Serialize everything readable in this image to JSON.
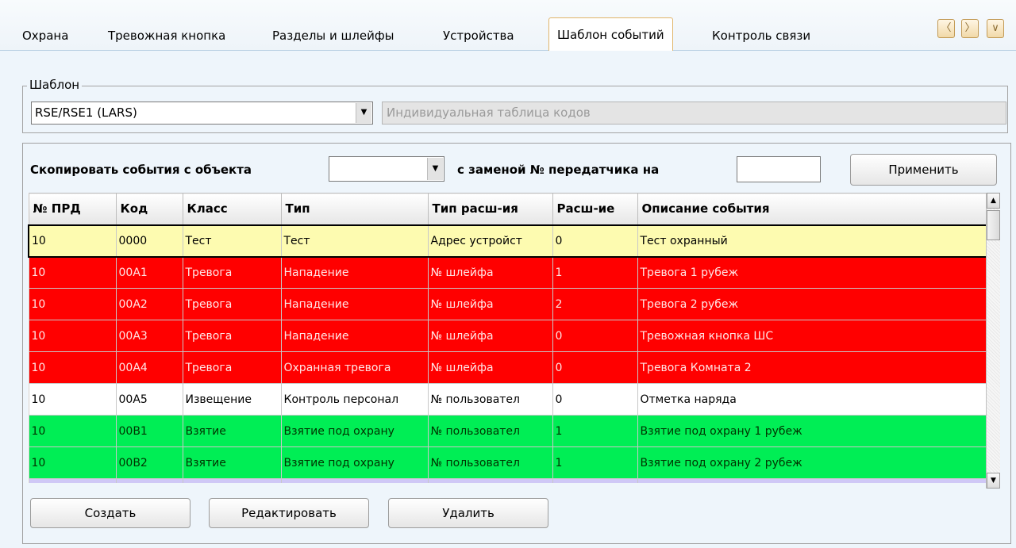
{
  "tabs": [
    {
      "label": "Охрана"
    },
    {
      "label": "Тревожная кнопка"
    },
    {
      "label": "Разделы и шлейфы"
    },
    {
      "label": "Устройства"
    },
    {
      "label": "Шаблон событий"
    },
    {
      "label": "Контроль связи"
    }
  ],
  "active_tab": "Шаблон событий",
  "template": {
    "legend": "Шаблон",
    "selected": "RSE/RSE1 (LARS)",
    "custom_codes_placeholder": "Индивидуальная таблица кодов"
  },
  "copy": {
    "label": "Скопировать события с объекта",
    "source_value": "",
    "replace_label": "с заменой № передатчика на",
    "replace_value": "",
    "apply_label": "Применить"
  },
  "table": {
    "columns": [
      "№ ПРД",
      "Код",
      "Класс",
      "Тип",
      "Тип расш-ия",
      "Расш-ие",
      "Описание события"
    ],
    "rows": [
      {
        "kind": "test",
        "cells": [
          "10",
          "0000",
          "Тест",
          "Тест",
          "Адрес устройст",
          "0",
          "Тест охранный"
        ]
      },
      {
        "kind": "alarm",
        "cells": [
          "10",
          "00A1",
          "Тревога",
          "Нападение",
          "№ шлейфа",
          "1",
          "Тревога 1 рубеж"
        ]
      },
      {
        "kind": "alarm",
        "cells": [
          "10",
          "00A2",
          "Тревога",
          "Нападение",
          "№ шлейфа",
          "2",
          "Тревога 2 рубеж"
        ]
      },
      {
        "kind": "alarm",
        "cells": [
          "10",
          "00A3",
          "Тревога",
          "Нападение",
          "№ шлейфа",
          "0",
          "Тревожная кнопка ШС"
        ]
      },
      {
        "kind": "alarm",
        "cells": [
          "10",
          "00A4",
          "Тревога",
          "Охранная тревога",
          "№ шлейфа",
          "0",
          "Тревога Комната 2"
        ]
      },
      {
        "kind": "info",
        "cells": [
          "10",
          "00A5",
          "Извещение",
          "Контроль персонал",
          "№ пользовател",
          "0",
          "Отметка наряда"
        ]
      },
      {
        "kind": "arm",
        "cells": [
          "10",
          "00B1",
          "Взятие",
          "Взятие под охрану",
          "№ пользовател",
          "1",
          "Взятие под охрану 1 рубеж"
        ]
      },
      {
        "kind": "arm",
        "cells": [
          "10",
          "00B2",
          "Взятие",
          "Взятие под охрану",
          "№ пользовател",
          "1",
          "Взятие под охрану 2 рубеж"
        ]
      },
      {
        "kind": "other",
        "cells": [
          "",
          "",
          "",
          "",
          "",
          "",
          ""
        ]
      }
    ]
  },
  "buttons": {
    "create": "Создать",
    "edit": "Редактировать",
    "delete": "Удалить"
  },
  "colors": {
    "test": "#fdfbb0",
    "alarm": "#ff0000",
    "info": "#ffffff",
    "arm": "#00ee55",
    "other": "#cfc8f6"
  }
}
